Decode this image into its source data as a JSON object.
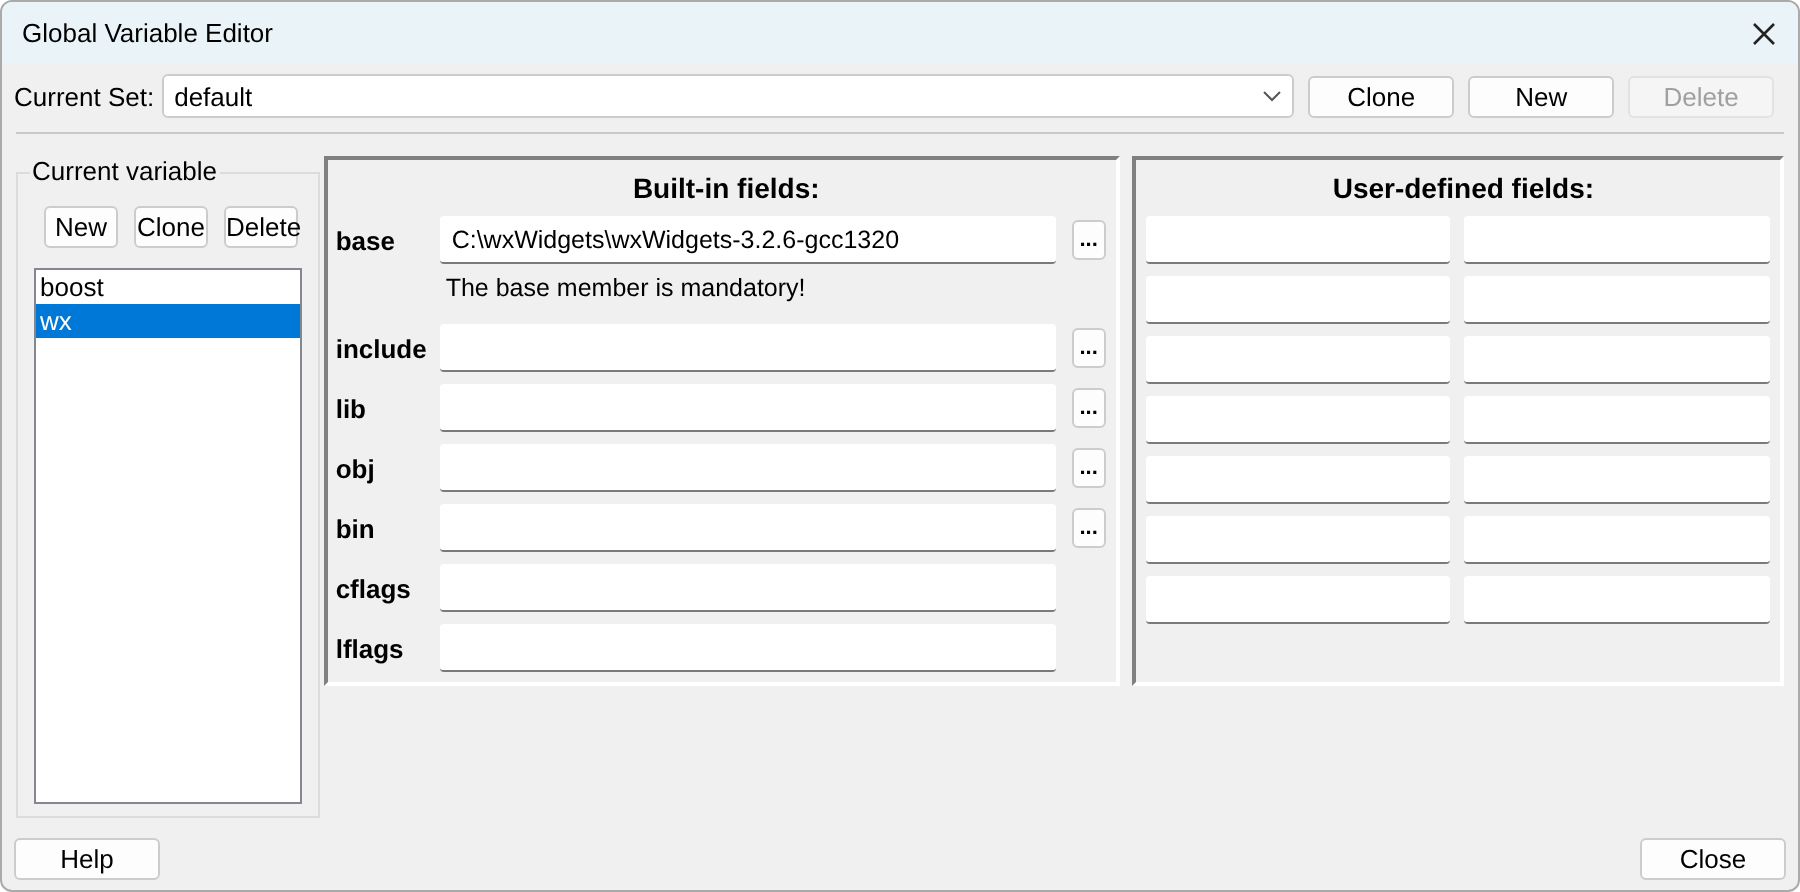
{
  "window": {
    "title": "Global Variable Editor"
  },
  "current_set": {
    "label": "Current Set:",
    "value": "default"
  },
  "set_buttons": [
    {
      "label": "Clone",
      "disabled": false
    },
    {
      "label": "New",
      "disabled": false
    },
    {
      "label": "Delete",
      "disabled": true
    }
  ],
  "current_variable": {
    "title": "Current variable",
    "buttons": [
      "New",
      "Clone",
      "Delete"
    ],
    "items": [
      {
        "label": "boost",
        "selected": false
      },
      {
        "label": "wx",
        "selected": true
      }
    ]
  },
  "builtin": {
    "title": "Built-in fields:",
    "fields": [
      {
        "label": "base",
        "value": "C:\\wxWidgets\\wxWidgets-3.2.6-gcc1320",
        "browse": "...",
        "note": "The base member is mandatory!"
      },
      {
        "label": "include",
        "browse": "..."
      },
      {
        "label": "lib",
        "browse": "..."
      },
      {
        "label": "obj",
        "browse": "..."
      },
      {
        "label": "bin",
        "browse": "..."
      },
      {
        "label": "cflags"
      },
      {
        "label": "lflags"
      }
    ]
  },
  "user_defined": {
    "title": "User-defined fields:"
  },
  "footer": {
    "help": "Help",
    "close": "Close"
  }
}
